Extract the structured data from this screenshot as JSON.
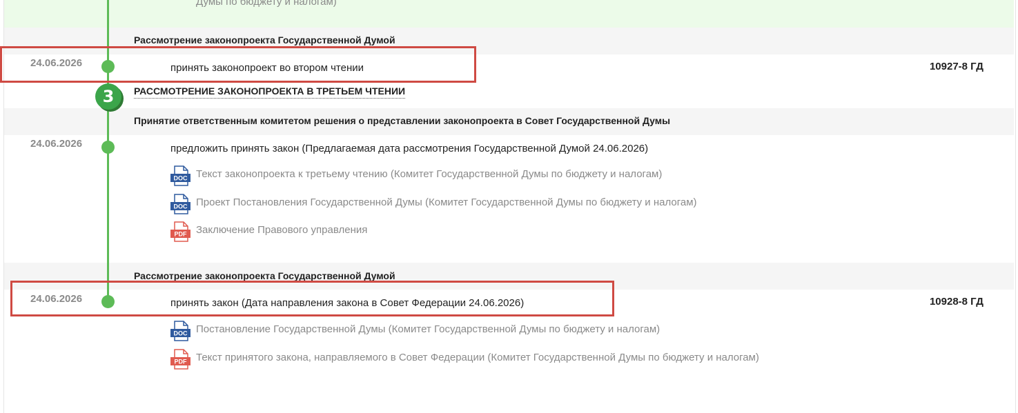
{
  "top_band": {
    "text": "Думы по бюджету и налогам)"
  },
  "events": [
    {
      "title": "Рассмотрение законопроекта Государственной Думой",
      "date": "24.06.2026",
      "decision": "принять законопроект во втором чтении",
      "number": "10927-8 ГД"
    },
    {
      "title": "Принятие ответственным комитетом решения о представлении законопроекта в Совет Государственной Думы",
      "date": "24.06.2026",
      "decision": "предложить принять закон (Предлагаемая дата рассмотрения Государственной Думой 24.06.2026)",
      "documents": [
        {
          "type": "DOC",
          "text": "Текст законопроекта к третьему чтению (Комитет Государственной Думы по бюджету и налогам)"
        },
        {
          "type": "DOC",
          "text": "Проект Постановления Государственной Думы (Комитет Государственной Думы по бюджету и налогам)"
        },
        {
          "type": "PDF",
          "text": "Заключение Правового управления"
        }
      ]
    },
    {
      "title": "Рассмотрение законопроекта Государственной Думой",
      "date": "24.06.2026",
      "decision": "принять закон (Дата направления закона в Совет Федерации 24.06.2026)",
      "number": "10928-8 ГД",
      "documents": [
        {
          "type": "DOC",
          "text": "Постановление Государственной Думы (Комитет Государственной Думы по бюджету и налогам)"
        },
        {
          "type": "PDF",
          "text": "Текст принятого закона, направляемого в Совет Федерации (Комитет Государственной Думы по бюджету и налогам)"
        }
      ]
    }
  ],
  "stage": {
    "number": "3",
    "title": "РАССМОТРЕНИЕ ЗАКОНОПРОЕКТА В ТРЕТЬЕМ ЧТЕНИИ"
  },
  "colors": {
    "timeline": "#5dbb57",
    "highlight": "#cf4a43",
    "doc": "#2f5a9e",
    "pdf": "#e05a4f",
    "band": "#ecfbe9"
  }
}
